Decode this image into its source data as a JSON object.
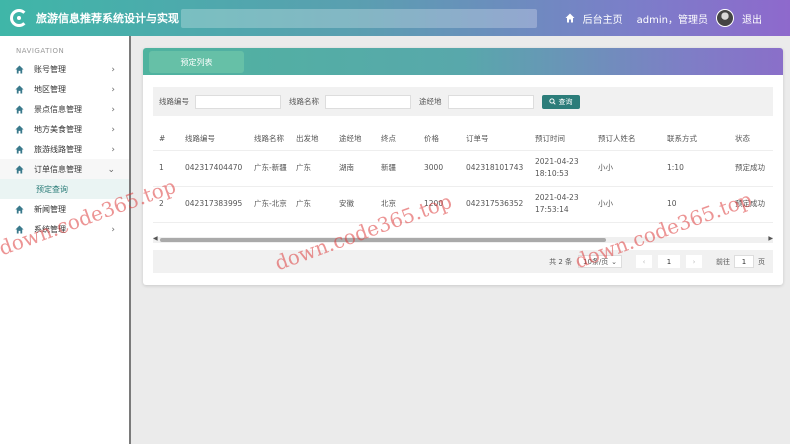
{
  "header": {
    "title": "旅游信息推荐系统设计与实现",
    "home_label": "后台主页",
    "user_label": "admin，管理员",
    "logout_label": "退出"
  },
  "sidebar": {
    "caption": "NAVIGATION",
    "items": [
      {
        "label": "账号管理",
        "icon": "home-icon"
      },
      {
        "label": "地区管理",
        "icon": "home-icon"
      },
      {
        "label": "景点信息管理",
        "icon": "home-icon"
      },
      {
        "label": "地方美食管理",
        "icon": "home-icon"
      },
      {
        "label": "旅游线路管理",
        "icon": "home-icon"
      },
      {
        "label": "订单信息管理",
        "icon": "home-icon"
      },
      {
        "label": "新闻管理",
        "icon": "home-icon"
      },
      {
        "label": "系统管理",
        "icon": "home-icon"
      }
    ],
    "active_sub": "预定查询"
  },
  "card": {
    "tab_label": "预定列表"
  },
  "filters": {
    "route_no_label": "线路编号",
    "route_name_label": "线路名称",
    "via_label": "途经地",
    "search_label": "查询"
  },
  "table": {
    "headers": [
      "#",
      "线路编号",
      "线路名称",
      "出发地",
      "途经地",
      "终点",
      "价格",
      "订单号",
      "预订时间",
      "预订人姓名",
      "联系方式",
      "状态"
    ],
    "rows": [
      [
        "1",
        "042317404470",
        "广东-新疆",
        "广东",
        "湖南",
        "新疆",
        "3000",
        "042318101743",
        "2021-04-23 18:10:53",
        "小小",
        "1:10",
        "预定成功"
      ],
      [
        "2",
        "042317383995",
        "广东-北京",
        "广东",
        "安徽",
        "北京",
        "1200",
        "042317536352",
        "2021-04-23 17:53:14",
        "小小",
        "10",
        "预定成功"
      ]
    ]
  },
  "pager": {
    "total": "共 2 条",
    "page_size": "10条/页",
    "current": "1",
    "goto_label": "前往",
    "goto_value": "1",
    "page_suffix": "页"
  },
  "watermark": "down.code365.top",
  "colors": {
    "accent": "#2c7d7a",
    "header_start": "#3fb6a8",
    "header_end": "#8e69cc",
    "watermark": "#dc3c3c"
  }
}
